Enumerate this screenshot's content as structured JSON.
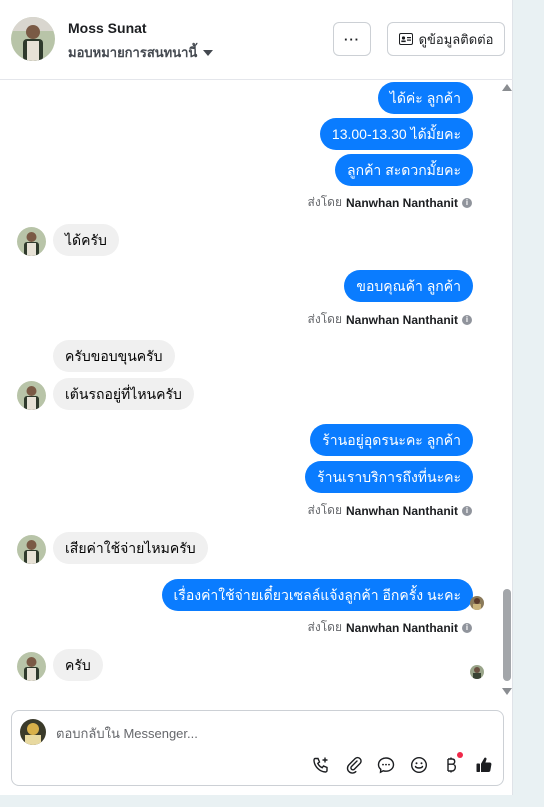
{
  "header": {
    "name": "Moss Sunat",
    "assign_label": "มอบหมายการสนทนานี้",
    "more_label": "···",
    "contact_button_label": "ดูข้อมูลติดต่อ"
  },
  "messages": {
    "m1": "ได้ค่ะ  ลูกค้า",
    "m2": "13.00-13.30 ได้มั้ยคะ",
    "m3": "ลูกค้า สะดวกมั้ยคะ",
    "m4": "ได้ครับ",
    "m5": "ขอบคุณค้า  ลูกค้า",
    "m6": "ครับขอบขุนครับ",
    "m7": "เต้นรถอยู่ที่ไหนครับ",
    "m8": "ร้านอยู่อุดรนะคะ  ลูกค้า",
    "m9": "ร้านเราบริการถึงที่นะคะ",
    "m10": "เสียค่าใช้จ่ายไหมครับ",
    "m11": "เรื่องค่าใช้จ่ายเดี๋ยวเซลล์แจ้งลูกค้า อีกครั้ง นะคะ",
    "m12": "ครับ"
  },
  "sent_by": {
    "prefix": "ส่งโดย",
    "agent": "Nanwhan Nanthanit"
  },
  "composer": {
    "placeholder": "ตอบกลับใน Messenger..."
  },
  "colors": {
    "outgoing_bubble": "#0a7cff",
    "incoming_bubble": "#f0f0f0"
  }
}
